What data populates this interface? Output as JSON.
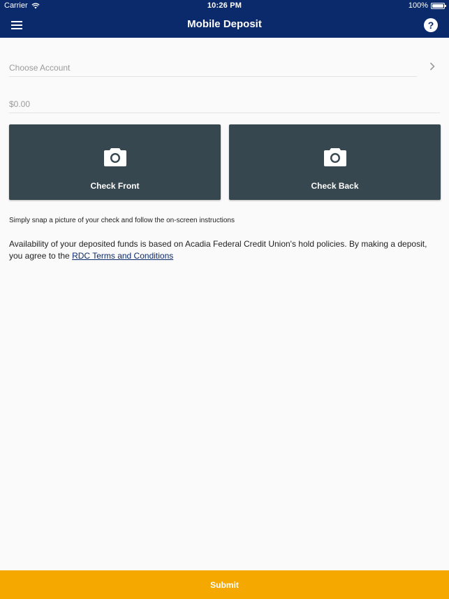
{
  "status_bar": {
    "carrier": "Carrier",
    "time": "10:26 PM",
    "battery": "100%"
  },
  "nav": {
    "title": "Mobile Deposit",
    "help_label": "?"
  },
  "form": {
    "account_placeholder": "Choose Account",
    "amount_placeholder": "$0.00"
  },
  "check_tiles": [
    {
      "label": "Check Front",
      "icon": "camera-icon"
    },
    {
      "label": "Check Back",
      "icon": "camera-icon"
    }
  ],
  "instructions": "Simply snap a picture of your check and follow the on-screen instructions",
  "disclaimer": {
    "text": "Availability of your deposited funds is based on Acadia Federal Credit Union's hold policies. By making a deposit, you agree to the ",
    "link_text": "RDC Terms and Conditions"
  },
  "submit_label": "Submit",
  "colors": {
    "header": "#0b2a6b",
    "tile": "#37474f",
    "submit": "#f4a800",
    "link": "#0b2a6b"
  }
}
